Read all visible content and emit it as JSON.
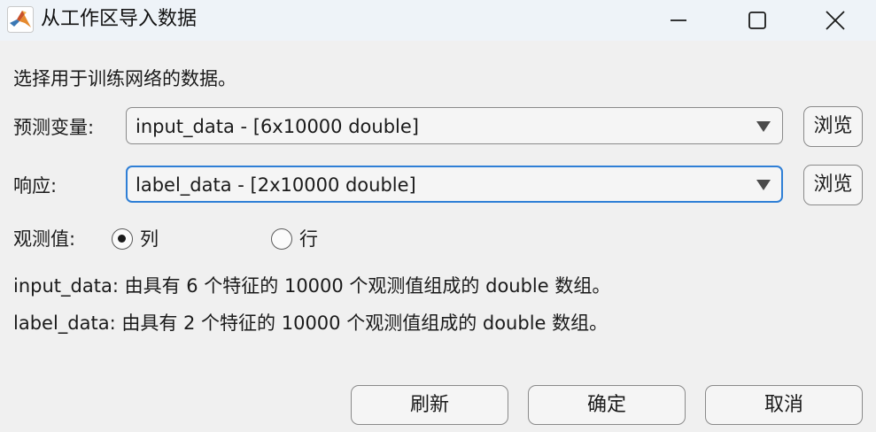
{
  "window": {
    "title": "从工作区导入数据",
    "icon": "matlab-icon"
  },
  "instruction": "选择用于训练网络的数据。",
  "predictors": {
    "label": "预测变量:",
    "value": "input_data - [6x10000 double]",
    "browse_label": "浏览"
  },
  "responses": {
    "label": "响应:",
    "value": "label_data - [2x10000 double]",
    "browse_label": "浏览"
  },
  "observations": {
    "label": "观测值:",
    "options": [
      {
        "label": "列",
        "selected": true
      },
      {
        "label": "行",
        "selected": false
      }
    ]
  },
  "info_lines": [
    "input_data: 由具有 6 个特征的 10000 个观测值组成的 double 数组。",
    "label_data: 由具有 2 个特征的 10000 个观测值组成的 double 数组。"
  ],
  "buttons": {
    "refresh": "刷新",
    "ok": "确定",
    "cancel": "取消"
  },
  "colors": {
    "focus_border": "#2f7fd6",
    "titlebar_bg": "#eef3f8",
    "window_bg": "#f0f0f0"
  }
}
